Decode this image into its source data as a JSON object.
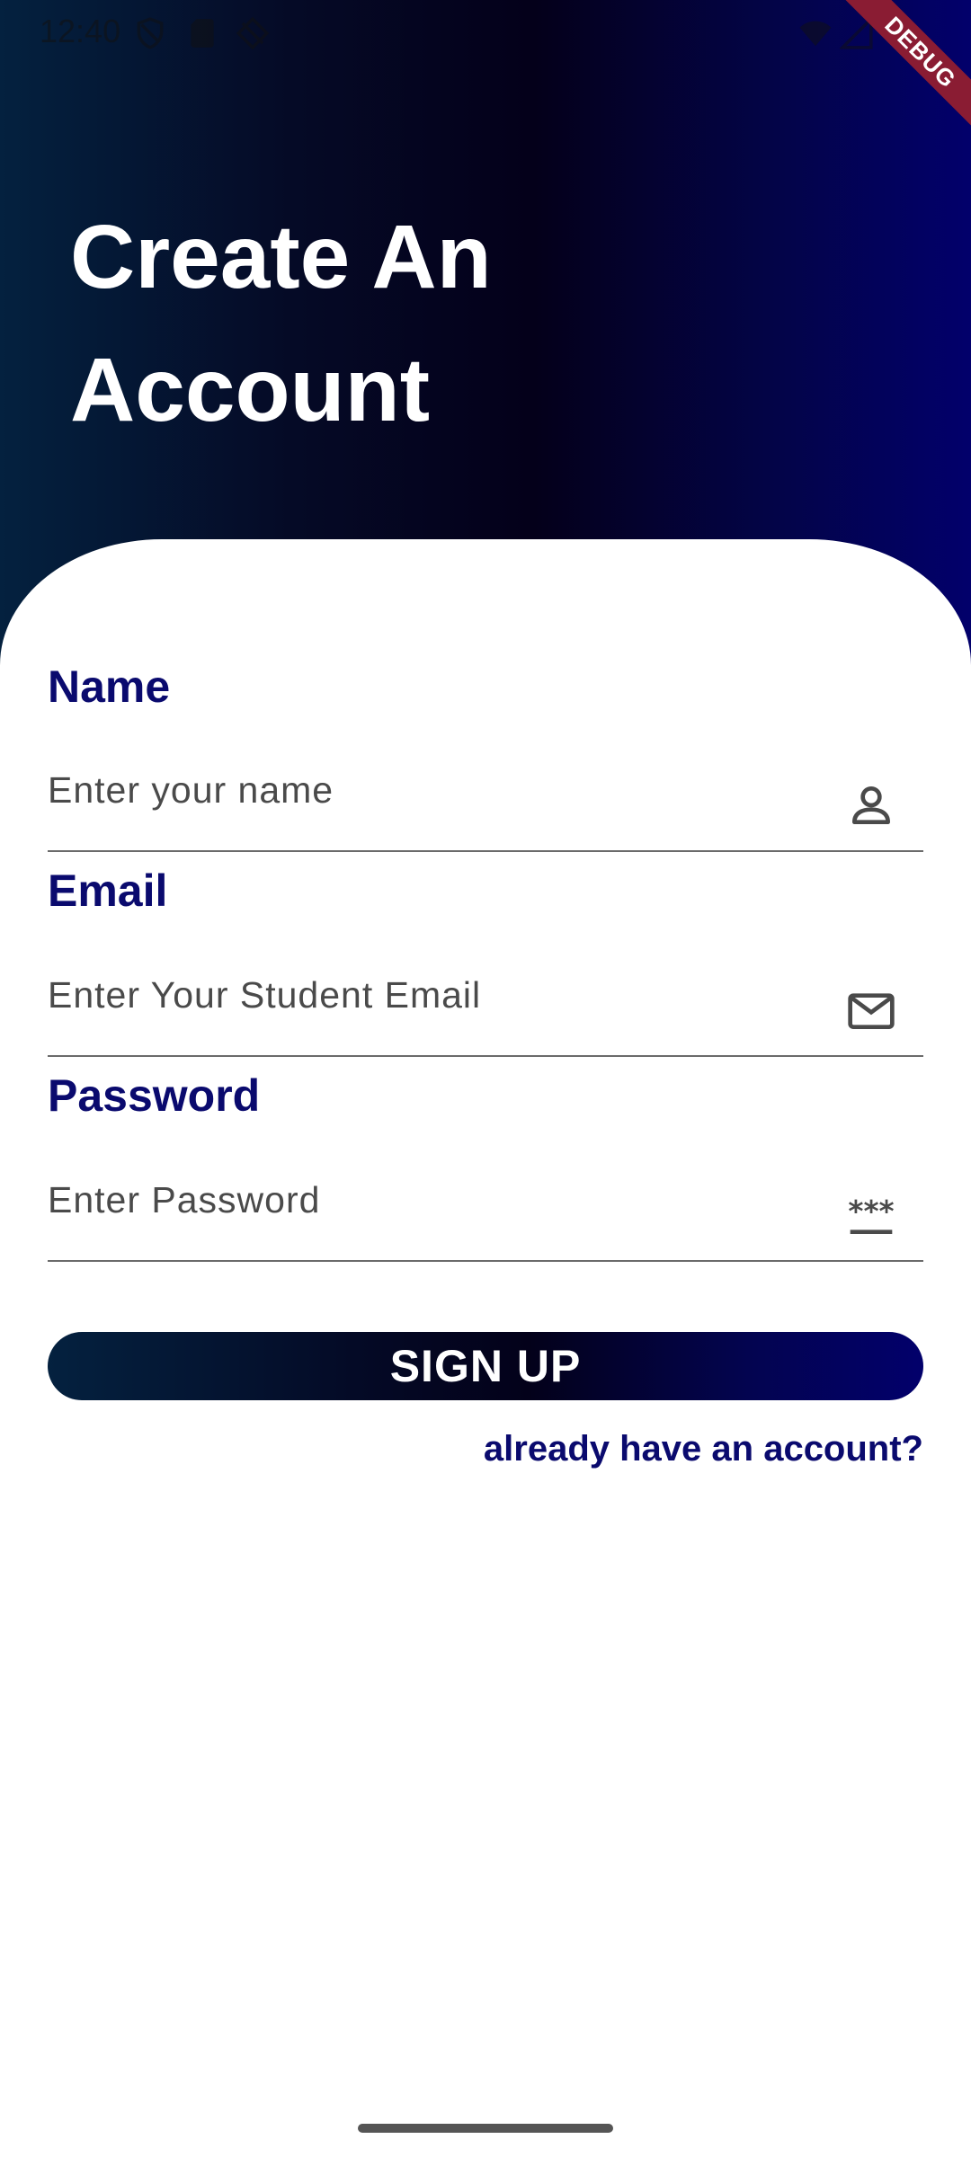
{
  "status_bar": {
    "time": "12:40",
    "icons": [
      "shield-icon",
      "sd-card-icon",
      "location-off-icon",
      "wifi-icon",
      "signal-icon"
    ]
  },
  "debug_banner": "DEBUG",
  "header": {
    "title": "Create An Account"
  },
  "form": {
    "name": {
      "label": "Name",
      "placeholder": "Enter your name",
      "icon": "person-icon"
    },
    "email": {
      "label": "Email",
      "placeholder": "Enter Your Student Email",
      "icon": "mail-icon"
    },
    "password": {
      "label": "Password",
      "placeholder": "Enter Password",
      "icon": "password-icon"
    },
    "signup_label": "SIGN UP",
    "login_link": "already have an account?"
  },
  "colors": {
    "accent": "#0a0a6e",
    "gradient_start": "#04213f",
    "gradient_end": "#02006b",
    "debug": "#8a1c33"
  }
}
